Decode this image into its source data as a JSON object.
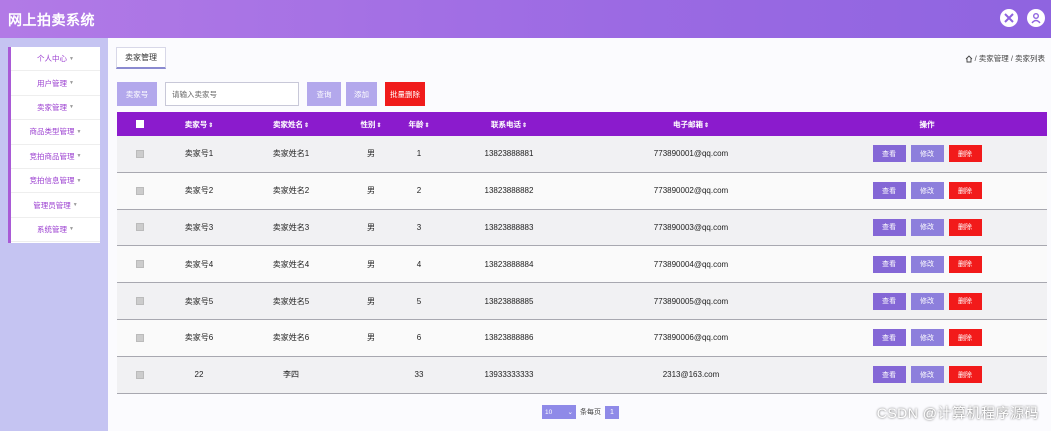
{
  "header": {
    "title": "网上拍卖系统"
  },
  "sidebar": {
    "items": [
      {
        "label": "个人中心"
      },
      {
        "label": "用户管理"
      },
      {
        "label": "卖家管理"
      },
      {
        "label": "商品类型管理"
      },
      {
        "label": "竞拍商品管理"
      },
      {
        "label": "竞拍信息管理"
      },
      {
        "label": "管理员管理"
      },
      {
        "label": "系统管理"
      }
    ]
  },
  "main": {
    "tab_title": "卖家管理",
    "breadcrumb": "/ 卖家管理 / 卖家列表"
  },
  "search": {
    "label": "卖家号",
    "placeholder": "请输入卖家号",
    "query_label": "查询",
    "add_label": "添加",
    "batch_delete_label": "批量删除"
  },
  "table": {
    "columns": [
      "卖家号",
      "卖家姓名",
      "性别",
      "年龄",
      "联系电话",
      "电子邮箱",
      "操作"
    ],
    "rows": [
      {
        "seller_no": "卖家号1",
        "name": "卖家姓名1",
        "gender": "男",
        "age": "1",
        "phone": "13823888881",
        "email": "773890001@qq.com"
      },
      {
        "seller_no": "卖家号2",
        "name": "卖家姓名2",
        "gender": "男",
        "age": "2",
        "phone": "13823888882",
        "email": "773890002@qq.com"
      },
      {
        "seller_no": "卖家号3",
        "name": "卖家姓名3",
        "gender": "男",
        "age": "3",
        "phone": "13823888883",
        "email": "773890003@qq.com"
      },
      {
        "seller_no": "卖家号4",
        "name": "卖家姓名4",
        "gender": "男",
        "age": "4",
        "phone": "13823888884",
        "email": "773890004@qq.com"
      },
      {
        "seller_no": "卖家号5",
        "name": "卖家姓名5",
        "gender": "男",
        "age": "5",
        "phone": "13823888885",
        "email": "773890005@qq.com"
      },
      {
        "seller_no": "卖家号6",
        "name": "卖家姓名6",
        "gender": "男",
        "age": "6",
        "phone": "13823888886",
        "email": "773890006@qq.com"
      },
      {
        "seller_no": "22",
        "name": "李四",
        "gender": "",
        "age": "33",
        "phone": "13933333333",
        "email": "2313@163.com"
      }
    ],
    "actions": {
      "view": "查看",
      "edit": "修改",
      "delete": "删除"
    }
  },
  "pagination": {
    "page_size": "10",
    "per_page_label": "条每页",
    "current_page": "1"
  },
  "watermark": "CSDN @计算机程序源码",
  "colors": {
    "header": "#9b6ae3",
    "table_header": "#8b1bcd",
    "delete": "#f01b1b",
    "accent": "#b3a8ec"
  },
  "icons": [
    "expand-icon",
    "user-icon",
    "home-icon",
    "caret-down-icon"
  ]
}
